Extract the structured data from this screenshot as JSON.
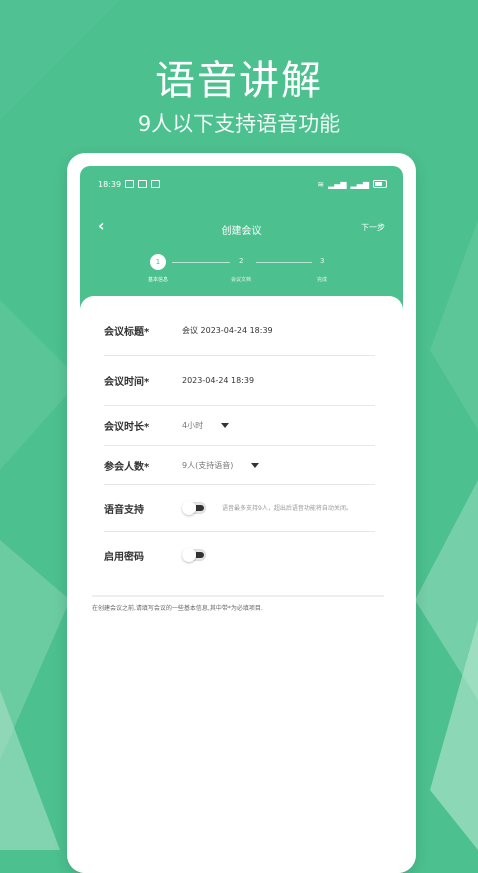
{
  "promo": {
    "title": "语音讲解",
    "subtitle": "9人以下支持语音功能"
  },
  "statusbar": {
    "time": "18:39",
    "left_icons": [
      "notification-icon",
      "signal-icon",
      "vibrate-icon"
    ],
    "right_icons": [
      "wifi-icon",
      "signal-icon",
      "signal-icon",
      "battery-icon"
    ]
  },
  "navbar": {
    "back_glyph": "‹",
    "title": "创建会议",
    "next_label": "下一步"
  },
  "steps": [
    {
      "number": "1",
      "label": "基本信息",
      "active": true
    },
    {
      "number": "2",
      "label": "会议文档",
      "active": false
    },
    {
      "number": "3",
      "label": "完成",
      "active": false
    }
  ],
  "form": {
    "title_label": "会议标题*",
    "title_value": "会议 2023-04-24 18:39",
    "time_label": "会议时间*",
    "time_value": "2023-04-24 18:39",
    "duration_label": "会议时长*",
    "duration_value": "4小时",
    "participants_label": "参会人数*",
    "participants_value": "9人(支持语音)",
    "voice_label": "语音支持",
    "voice_note": "语音最多支持9人，超出后语音功能将自动关闭。",
    "voice_enabled": false,
    "password_label": "启用密码",
    "password_enabled": false
  },
  "footnote": "在创建会议之前,请填写会议的一些基本信息,其中带*为必填项目.",
  "colors": {
    "brand": "#4cc08f",
    "white": "#ffffff"
  }
}
